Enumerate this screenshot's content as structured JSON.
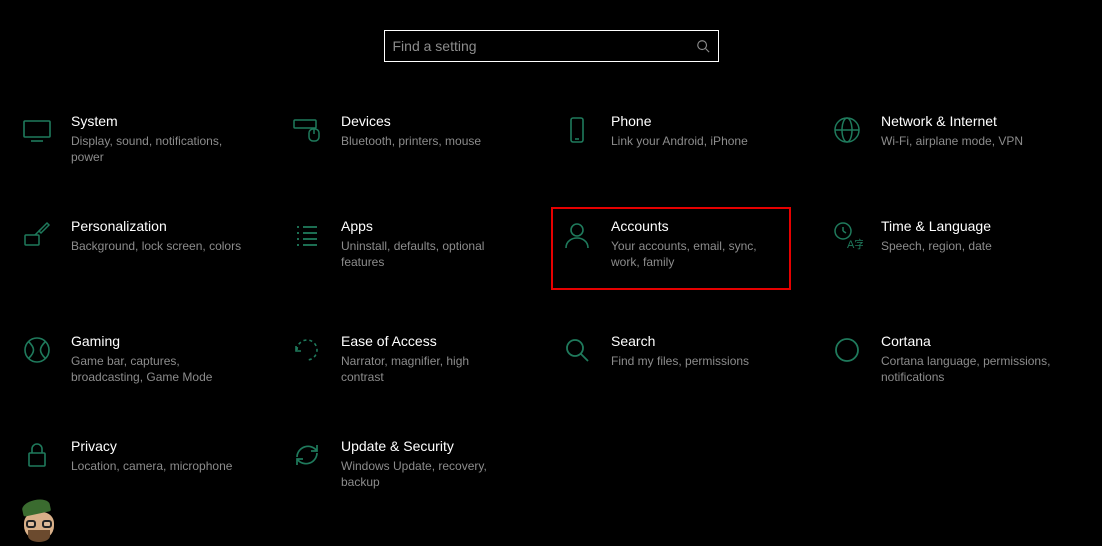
{
  "search": {
    "placeholder": "Find a setting"
  },
  "tiles": [
    {
      "id": "system",
      "title": "System",
      "desc": "Display, sound, notifications, power"
    },
    {
      "id": "devices",
      "title": "Devices",
      "desc": "Bluetooth, printers, mouse"
    },
    {
      "id": "phone",
      "title": "Phone",
      "desc": "Link your Android, iPhone"
    },
    {
      "id": "network",
      "title": "Network & Internet",
      "desc": "Wi-Fi, airplane mode, VPN"
    },
    {
      "id": "personalization",
      "title": "Personalization",
      "desc": "Background, lock screen, colors"
    },
    {
      "id": "apps",
      "title": "Apps",
      "desc": "Uninstall, defaults, optional features"
    },
    {
      "id": "accounts",
      "title": "Accounts",
      "desc": "Your accounts, email, sync, work, family",
      "highlighted": true
    },
    {
      "id": "time",
      "title": "Time & Language",
      "desc": "Speech, region, date"
    },
    {
      "id": "gaming",
      "title": "Gaming",
      "desc": "Game bar, captures, broadcasting, Game Mode"
    },
    {
      "id": "ease",
      "title": "Ease of Access",
      "desc": "Narrator, magnifier, high contrast"
    },
    {
      "id": "search",
      "title": "Search",
      "desc": "Find my files, permissions"
    },
    {
      "id": "cortana",
      "title": "Cortana",
      "desc": "Cortana language, permissions, notifications"
    },
    {
      "id": "privacy",
      "title": "Privacy",
      "desc": "Location, camera, microphone"
    },
    {
      "id": "update",
      "title": "Update & Security",
      "desc": "Windows Update, recovery, backup"
    }
  ]
}
